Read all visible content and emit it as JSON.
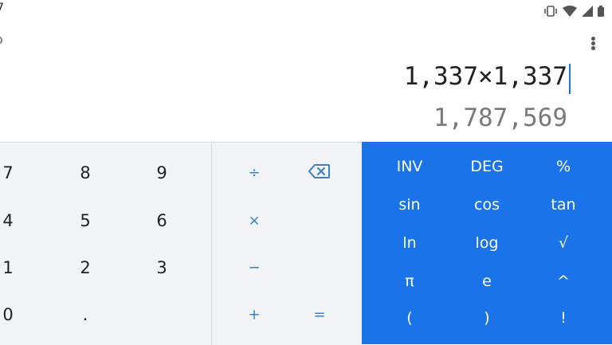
{
  "status": {
    "time": "7"
  },
  "toolbar": {
    "left_partial": "o"
  },
  "display": {
    "formula": "1,337×1,337",
    "result": "1,787,569"
  },
  "keypad": {
    "numeric": {
      "k7": "7",
      "k8": "8",
      "k9": "9",
      "k4": "4",
      "k5": "5",
      "k6": "6",
      "k1": "1",
      "k2": "2",
      "k3": "3",
      "k0": "0",
      "dot": "."
    },
    "ops": {
      "divide": "÷",
      "multiply": "×",
      "minus": "−",
      "plus": "+",
      "equals": "="
    },
    "advanced": {
      "inv": "INV",
      "deg": "DEG",
      "percent": "%",
      "sin": "sin",
      "cos": "cos",
      "tan": "tan",
      "ln": "ln",
      "log": "log",
      "sqrt": "√",
      "pi": "π",
      "e": "e",
      "power": "^",
      "lparen": "(",
      "rparen": ")",
      "factorial": "!"
    }
  },
  "colors": {
    "accent": "#1a73e8",
    "pad": "#f1f3f4",
    "op_text": "#3b7fc4",
    "result_text": "#7a7a7a"
  },
  "icons": [
    "vibrate-icon",
    "wifi-icon",
    "signal-icon",
    "battery-icon",
    "backspace-icon",
    "more-vert-icon"
  ]
}
